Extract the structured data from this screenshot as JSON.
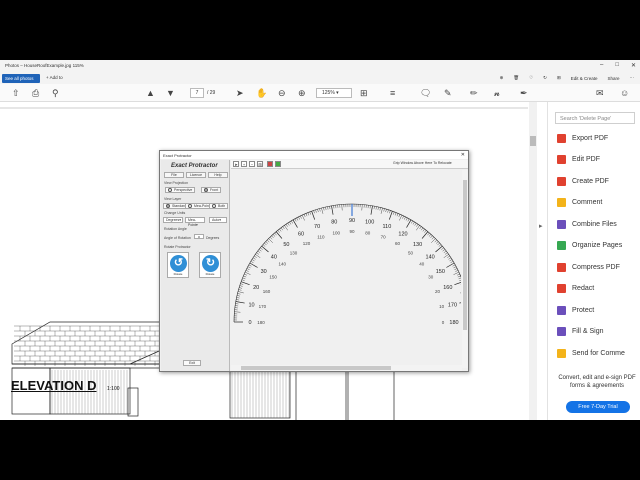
{
  "app": {
    "title": "Photos – HouseRoofExample.jpg",
    "zoom_percent": "115%",
    "tab_see_all": "See all photos",
    "tab_add": "+ Add to",
    "edit_create": "Edit & Create",
    "share": "Share"
  },
  "acrobat": {
    "page_current": "7",
    "page_total": "/ 29",
    "zoom": "125%"
  },
  "document": {
    "elevation_title": "ELEVATION D",
    "elevation_scale": "1:100"
  },
  "tools_pane": {
    "search_placeholder": "Search 'Delete Page'",
    "items": [
      {
        "label": "Export PDF",
        "color": "#e0412f"
      },
      {
        "label": "Edit PDF",
        "color": "#e0412f"
      },
      {
        "label": "Create PDF",
        "color": "#e0412f"
      },
      {
        "label": "Comment",
        "color": "#f3b31a"
      },
      {
        "label": "Combine Files",
        "color": "#6b4fbb"
      },
      {
        "label": "Organize Pages",
        "color": "#36a852"
      },
      {
        "label": "Compress PDF",
        "color": "#e0412f"
      },
      {
        "label": "Redact",
        "color": "#e0412f"
      },
      {
        "label": "Protect",
        "color": "#6b4fbb"
      },
      {
        "label": "Fill & Sign",
        "color": "#6b4fbb"
      },
      {
        "label": "Send for Comme",
        "color": "#f3b31a"
      }
    ],
    "promo_text": "Convert, edit and e-sign PDF forms & agreements",
    "promo_button": "Free 7-Day Trial"
  },
  "protractor": {
    "window_title": "Exact Protractor",
    "heading": "Exact Protractor",
    "menu": [
      "File",
      "Licence",
      "Help"
    ],
    "view_projection_label": "View Projection",
    "projection_options": [
      "Perspective",
      "Front"
    ],
    "view_layer_label": "View Layer",
    "layer_options": [
      "Standard",
      "Mea-Point",
      "Both"
    ],
    "change_units_label": "Change Units",
    "units_dropdown": "Degrees",
    "mea_point_dropdown": "Mea-Point",
    "auto_dropdown": "Auto",
    "rotation_angle_label": "Rotation Angle",
    "angle_of_rotation_label": "Angle of Rotation",
    "angle_value": "0",
    "degrees_label": "Degrees",
    "rotate_protractor_label": "Rotate Protractor",
    "rotate_left_label": "Rotate",
    "rotate_right_label": "Rotate",
    "exit_label": "Exit",
    "ontop_label": "Grip Window Above Here To Relocate",
    "scale_labels": [
      "0",
      "10",
      "20",
      "30",
      "40",
      "50",
      "60",
      "70",
      "80",
      "90",
      "100",
      "110",
      "120",
      "130",
      "140",
      "150",
      "160",
      "170",
      "180"
    ],
    "scale_labels_inner": [
      "180",
      "170",
      "160",
      "150",
      "140",
      "130",
      "120",
      "110",
      "100",
      "90",
      "80",
      "70",
      "60",
      "50",
      "40",
      "30",
      "20",
      "10",
      "0"
    ]
  }
}
